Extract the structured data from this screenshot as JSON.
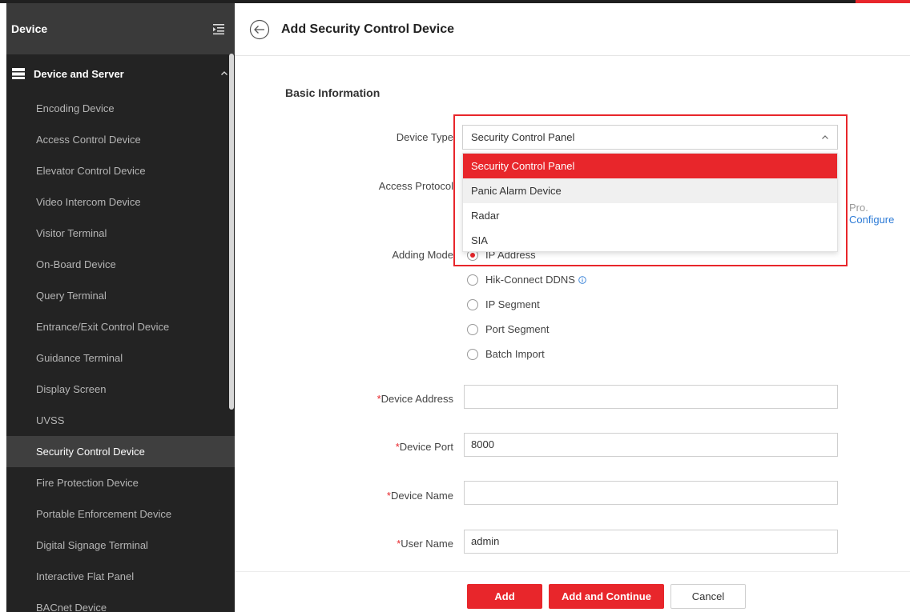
{
  "sidebar": {
    "title": "Device",
    "group_label": "Device and Server",
    "items": [
      {
        "label": "Encoding Device"
      },
      {
        "label": "Access Control Device"
      },
      {
        "label": "Elevator Control Device"
      },
      {
        "label": "Video Intercom Device"
      },
      {
        "label": "Visitor Terminal"
      },
      {
        "label": "On-Board Device"
      },
      {
        "label": "Query Terminal"
      },
      {
        "label": "Entrance/Exit Control Device"
      },
      {
        "label": "Guidance Terminal"
      },
      {
        "label": "Display Screen"
      },
      {
        "label": "UVSS"
      },
      {
        "label": "Security Control Device"
      },
      {
        "label": "Fire Protection Device"
      },
      {
        "label": "Portable Enforcement Device"
      },
      {
        "label": "Digital Signage Terminal"
      },
      {
        "label": "Interactive Flat Panel"
      },
      {
        "label": "BACnet Device"
      }
    ],
    "active_item": "Security Control Device"
  },
  "header": {
    "title": "Add Security Control Device"
  },
  "form": {
    "section_title": "Basic Information",
    "device_type": {
      "label": "Device Type",
      "value": "Security Control Panel",
      "options": [
        "Security Control Panel",
        "Panic Alarm Device",
        "Radar",
        "SIA"
      ]
    },
    "access_protocol": {
      "label": "Access Protocol",
      "hint_fragment": "Pro.",
      "link": "Configure"
    },
    "adding_mode": {
      "label": "Adding Mode",
      "options": [
        "IP Address",
        "Hik-Connect DDNS",
        "IP Segment",
        "Port Segment",
        "Batch Import"
      ],
      "selected": "IP Address"
    },
    "required_mark": "*",
    "device_address": {
      "label": "Device Address",
      "value": ""
    },
    "device_port": {
      "label": "Device Port",
      "value": "8000"
    },
    "device_name": {
      "label": "Device Name",
      "value": ""
    },
    "user_name": {
      "label": "User Name",
      "value": "admin"
    }
  },
  "buttons": {
    "add": "Add",
    "add_continue": "Add and Continue",
    "cancel": "Cancel"
  },
  "colors": {
    "accent": "#e8262b",
    "sidebar_bg": "#232323",
    "link": "#2d7bd6"
  }
}
